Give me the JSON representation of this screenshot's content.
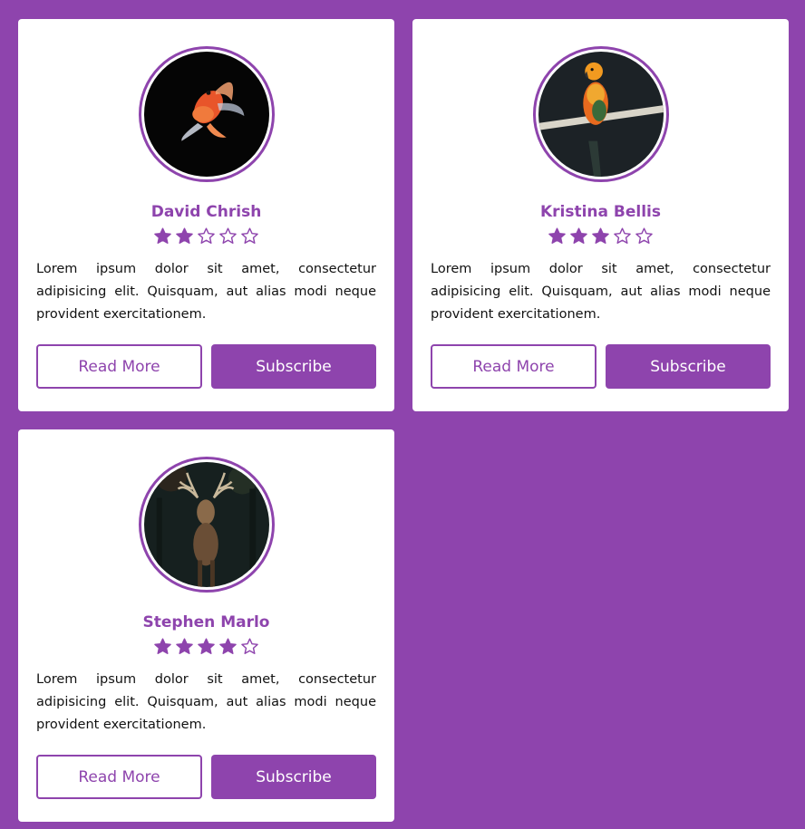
{
  "theme": {
    "accent": "#8e44ad",
    "card_bg": "#ffffff",
    "page_bg": "#8e44ad"
  },
  "cards": [
    {
      "name": "David Chrish",
      "image": "goldfish-photo",
      "rating": 2,
      "max_rating": 5,
      "description": "Lorem ipsum dolor sit amet, consectetur adipisicing elit. Quisquam, aut alias modi neque provident exercitationem.",
      "read_more_label": "Read More",
      "subscribe_label": "Subscribe"
    },
    {
      "name": "Kristina Bellis",
      "image": "parrot-photo",
      "rating": 3,
      "max_rating": 5,
      "description": "Lorem ipsum dolor sit amet, consectetur adipisicing elit. Quisquam, aut alias modi neque provident exercitationem.",
      "read_more_label": "Read More",
      "subscribe_label": "Subscribe"
    },
    {
      "name": "Stephen Marlo",
      "image": "deer-photo",
      "rating": 4,
      "max_rating": 5,
      "description": "Lorem ipsum dolor sit amet, consectetur adipisicing elit. Quisquam, aut alias modi neque provident exercitationem.",
      "read_more_label": "Read More",
      "subscribe_label": "Subscribe"
    }
  ]
}
